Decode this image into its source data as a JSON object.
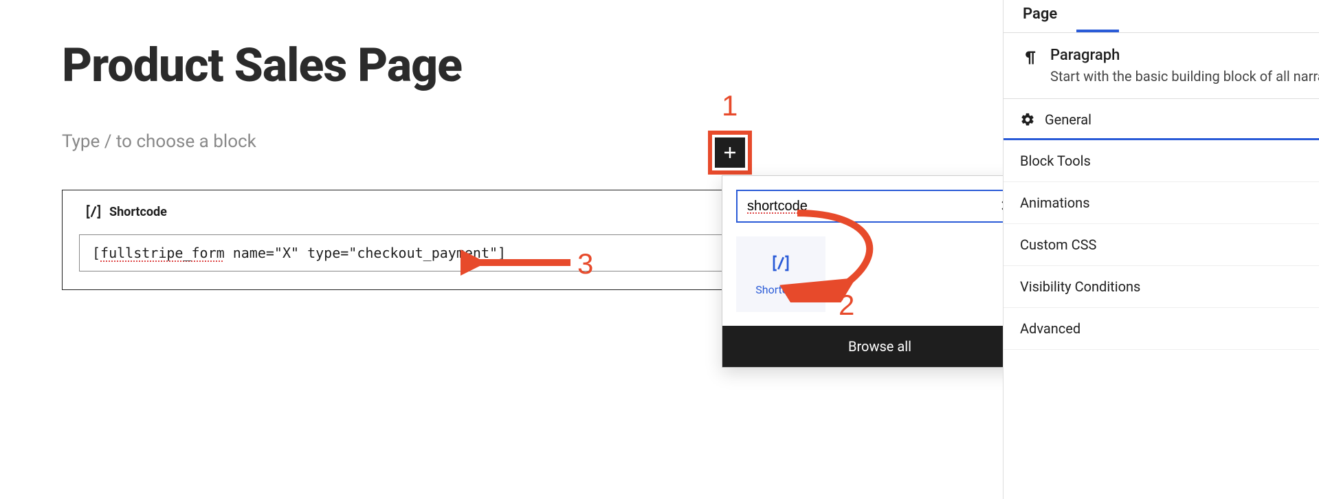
{
  "page": {
    "title": "Product Sales Page",
    "placeholder": "Type / to choose a block"
  },
  "shortcode_block": {
    "label": "Shortcode",
    "code_prefix": "[",
    "code_token": "fullstripe_form",
    "code_suffix": " name=\"X\" type=\"checkout_payment\"]"
  },
  "inserter": {
    "search_value": "shortcode",
    "result_label": "Shortcode",
    "browse_all": "Browse all"
  },
  "sidebar": {
    "tabs": {
      "page": "Page"
    },
    "block": {
      "name": "Paragraph",
      "desc": "Start with the basic building block of all narrative."
    },
    "rows": {
      "general": "General",
      "block_tools": "Block Tools",
      "animations": "Animations",
      "custom_css": "Custom CSS",
      "visibility": "Visibility Conditions",
      "advanced": "Advanced"
    }
  },
  "annotations": {
    "one": "1",
    "two": "2",
    "three": "3"
  }
}
